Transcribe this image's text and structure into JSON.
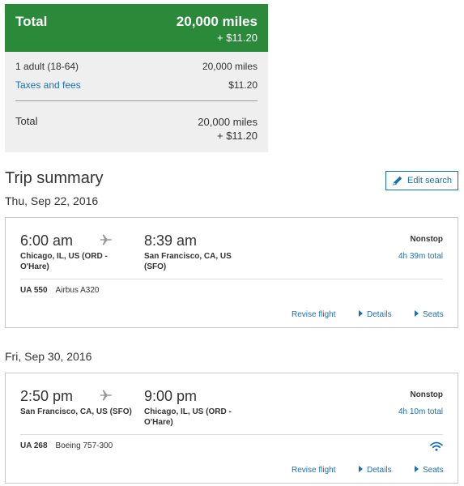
{
  "totals": {
    "header_label": "Total",
    "header_miles": "20,000 miles",
    "header_fee": "+ $11.20",
    "adult_label": "1 adult (18-64)",
    "adult_value": "20,000 miles",
    "taxes_label": "Taxes and fees",
    "taxes_value": "$11.20",
    "total_label": "Total",
    "total_miles": "20,000 miles",
    "total_fee": "+ $11.20"
  },
  "trip": {
    "title": "Trip summary",
    "edit_label": "Edit search"
  },
  "flights": [
    {
      "date": "Thu, Sep 22, 2016",
      "depart_time": "6:00 am",
      "depart_city_line1": "Chicago, IL, US (ORD -",
      "depart_city_line2": "O'Hare)",
      "arrive_time": "8:39 am",
      "arrive_city_line1": "San Francisco, CA, US",
      "arrive_city_line2": "(SFO)",
      "stops": "Nonstop",
      "duration": "4h 39m total",
      "flight_number": "UA 550",
      "aircraft": "Airbus A320",
      "revise_label": "Revise flight",
      "details_label": "Details",
      "seats_label": "Seats"
    },
    {
      "date": "Fri, Sep 30, 2016",
      "depart_time": "2:50 pm",
      "depart_city_line1": "San Francisco, CA, US (SFO)",
      "depart_city_line2": "",
      "arrive_time": "9:00 pm",
      "arrive_city_line1": "Chicago, IL, US (ORD -",
      "arrive_city_line2": "O'Hare)",
      "stops": "Nonstop",
      "duration": "4h 10m total",
      "flight_number": "UA 268",
      "aircraft": "Boeing 757-300",
      "revise_label": "Revise flight",
      "details_label": "Details",
      "seats_label": "Seats",
      "wifi_icon": "wifi-icon"
    }
  ],
  "colors": {
    "header_green": "#2a8a3a",
    "link_blue": "#1a6fb3",
    "panel_gray": "#efefef"
  }
}
